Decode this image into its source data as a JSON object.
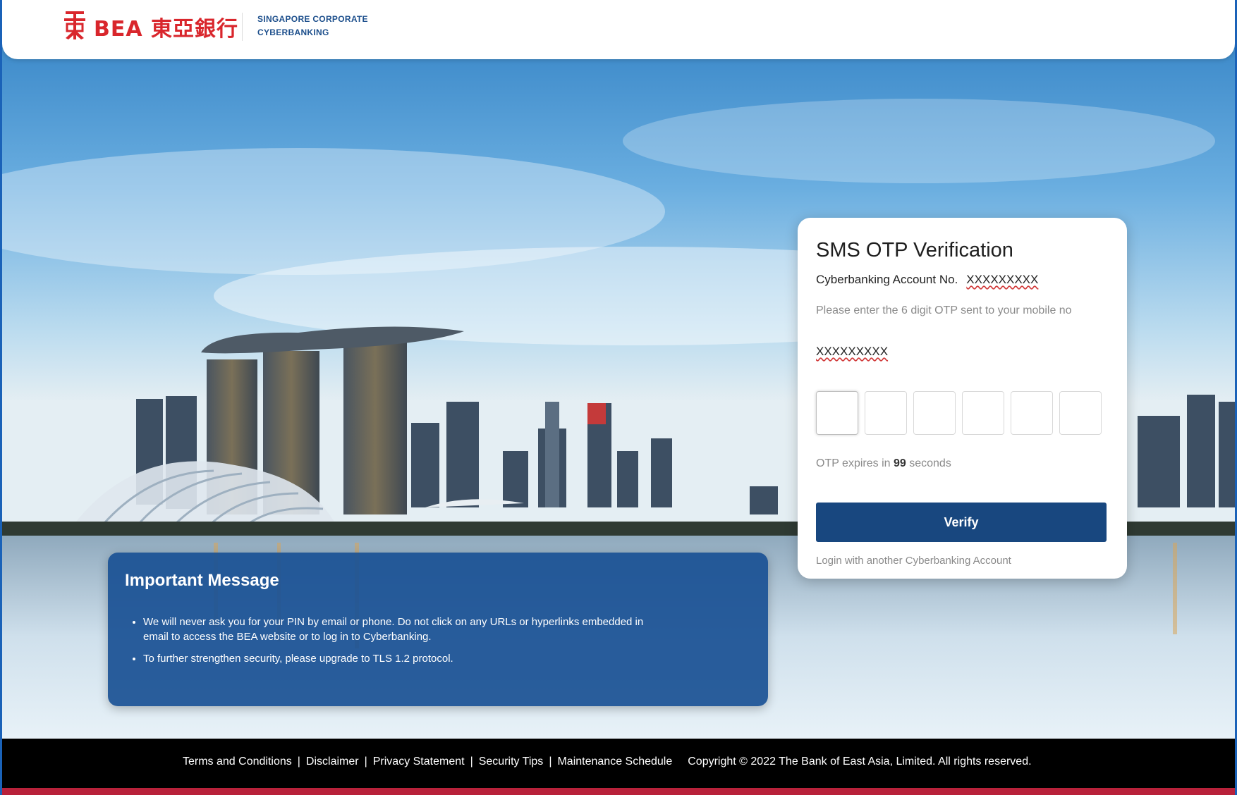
{
  "brand": {
    "name": "BEA 東亞銀行",
    "product_line1": "SINGAPORE CORPORATE",
    "product_line2": "CYBERBANKING",
    "color": "#d9262c"
  },
  "otp": {
    "title": "SMS OTP Verification",
    "account_label": "Cyberbanking Account No.",
    "account_number": "XXXXXXXXX",
    "instruction": "Please enter the 6 digit OTP sent to your mobile no",
    "mobile_number": "XXXXXXXXX",
    "digits": [
      "",
      "",
      "",
      "",
      "",
      ""
    ],
    "expiry_prefix": "OTP expires in",
    "expiry_seconds": "99",
    "expiry_suffix": "seconds",
    "verify_label": "Verify",
    "alt_login_label": "Login with another Cyberbanking Account",
    "button_color": "#18477f"
  },
  "message": {
    "title": "Important Message",
    "items": [
      "We will never ask you for your PIN by email or phone. Do not click on any URLs or hyperlinks embedded in email to access the BEA website or to log in to Cyberbanking.",
      "To further strengthen security, please upgrade to TLS 1.2 protocol."
    ]
  },
  "footer": {
    "links": [
      "Terms and Conditions",
      "Disclaimer",
      "Privacy Statement",
      "Security Tips",
      "Maintenance Schedule"
    ],
    "separator": "|",
    "copyright": "Copyright © 2022 The Bank of East Asia, Limited. All rights reserved."
  }
}
